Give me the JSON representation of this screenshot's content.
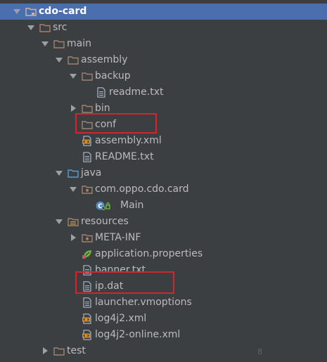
{
  "project_tree": {
    "nodes": [
      {
        "label": "cdo-card",
        "icon": "module-folder-icon",
        "state": "expanded",
        "selected": true
      },
      {
        "label": "src",
        "icon": "folder-icon",
        "state": "expanded"
      },
      {
        "label": "main",
        "icon": "folder-icon",
        "state": "expanded"
      },
      {
        "label": "assembly",
        "icon": "folder-icon",
        "state": "expanded"
      },
      {
        "label": "backup",
        "icon": "folder-icon",
        "state": "expanded"
      },
      {
        "label": "readme.txt",
        "icon": "text-file-icon",
        "state": "leaf"
      },
      {
        "label": "bin",
        "icon": "folder-icon",
        "state": "collapsed"
      },
      {
        "label": "conf",
        "icon": "folder-icon",
        "state": "leaf"
      },
      {
        "label": "assembly.xml",
        "icon": "xml-file-icon",
        "state": "leaf"
      },
      {
        "label": "README.txt",
        "icon": "text-file-icon",
        "state": "leaf"
      },
      {
        "label": "java",
        "icon": "source-folder-icon",
        "state": "expanded"
      },
      {
        "label": "com.oppo.cdo.card",
        "icon": "package-icon",
        "state": "expanded"
      },
      {
        "label": "Main",
        "icon": "java-class-icon",
        "state": "leaf"
      },
      {
        "label": "resources",
        "icon": "resources-folder-icon",
        "state": "expanded"
      },
      {
        "label": "META-INF",
        "icon": "package-icon",
        "state": "collapsed"
      },
      {
        "label": "application.properties",
        "icon": "spring-properties-icon",
        "state": "leaf"
      },
      {
        "label": "banner.txt",
        "icon": "text-file-icon",
        "state": "leaf"
      },
      {
        "label": "ip.dat",
        "icon": "text-file-icon",
        "state": "leaf"
      },
      {
        "label": "launcher.vmoptions",
        "icon": "text-file-icon",
        "state": "leaf"
      },
      {
        "label": "log4j2.xml",
        "icon": "xml-file-icon",
        "state": "leaf"
      },
      {
        "label": "log4j2-online.xml",
        "icon": "xml-file-icon",
        "state": "leaf"
      },
      {
        "label": "test",
        "icon": "folder-icon",
        "state": "collapsed"
      }
    ],
    "annotations": [
      "conf",
      "ip.dat"
    ]
  },
  "corner_mark": "8",
  "colors": {
    "background": "#3c3f41",
    "selection": "#4b6eaf",
    "folder": "#a0826d",
    "source_folder": "#5c9ccf",
    "annotation_box": "#d6242c"
  }
}
